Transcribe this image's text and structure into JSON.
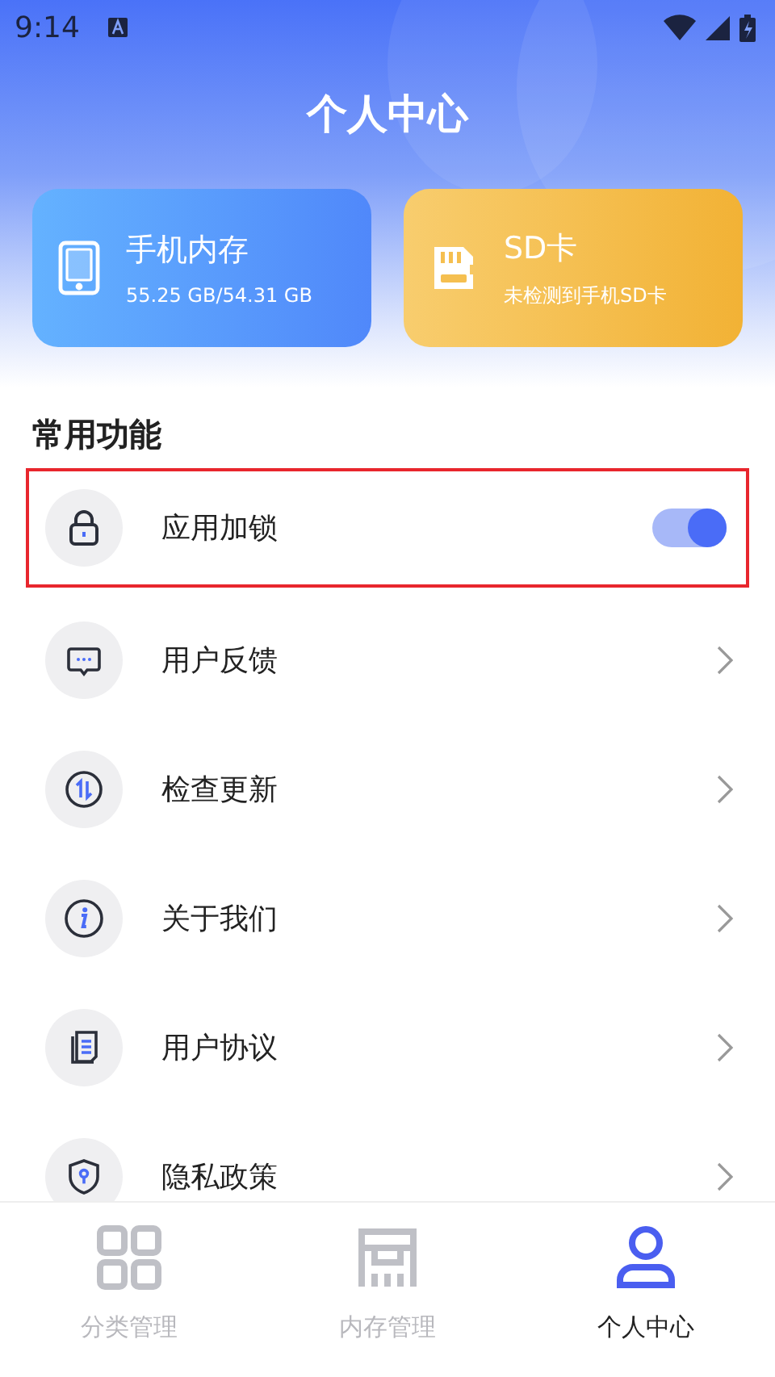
{
  "status_bar": {
    "time": "9:14"
  },
  "header": {
    "title": "个人中心"
  },
  "storage_cards": [
    {
      "kind": "phone",
      "title": "手机内存",
      "subtitle": "55.25 GB/54.31 GB"
    },
    {
      "kind": "sd",
      "title": "SD卡",
      "subtitle": "未检测到手机SD卡"
    }
  ],
  "section": {
    "title": "常用功能"
  },
  "menu_items": [
    {
      "kind": "toggle",
      "label": "应用加锁",
      "on": true,
      "highlighted": true
    },
    {
      "kind": "link",
      "label": "用户反馈",
      "highlighted": false
    },
    {
      "kind": "link",
      "label": "检查更新",
      "highlighted": false
    },
    {
      "kind": "link",
      "label": "关于我们",
      "highlighted": false
    },
    {
      "kind": "link",
      "label": "用户协议",
      "highlighted": false
    },
    {
      "kind": "link",
      "label": "隐私政策",
      "highlighted": false
    }
  ],
  "bottom_nav": [
    {
      "label": "分类管理",
      "selected": false
    },
    {
      "label": "内存管理",
      "selected": false
    },
    {
      "label": "个人中心",
      "selected": true
    }
  ]
}
